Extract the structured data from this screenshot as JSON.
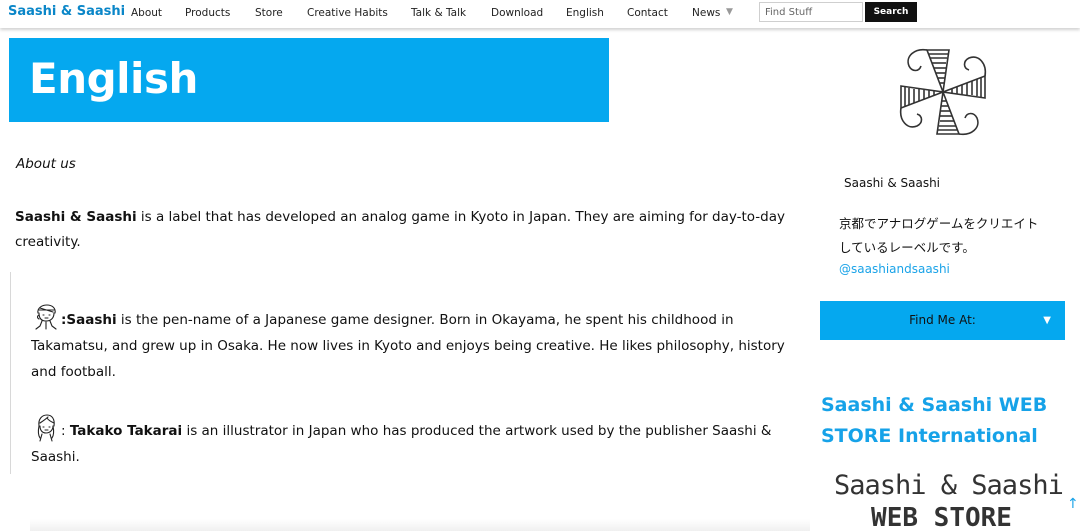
{
  "nav": {
    "brand": "Saashi & Saashi",
    "items": [
      {
        "label": "About"
      },
      {
        "label": "Products"
      },
      {
        "label": "Store"
      },
      {
        "label": "Creative Habits"
      },
      {
        "label": "Talk & Talk"
      },
      {
        "label": "Download"
      },
      {
        "label": "English"
      },
      {
        "label": "Contact"
      },
      {
        "label": "News"
      }
    ],
    "search_placeholder": "Find Stuff",
    "search_button": "Search"
  },
  "banner": {
    "title": "English"
  },
  "main": {
    "about_heading": "About us",
    "intro_bold": "Saashi & Saashi",
    "intro_rest": " is a label that has developed an analog game in Kyoto in Japan.  They are aiming for day-to-day creativity.",
    "person1": {
      "bold": ":Saashi",
      "text": " is the pen-name of a Japanese game designer.  Born in Okayama, he spent his childhood in Takamatsu, and grew up in Osaka. He now lives in Kyoto and enjoys being creative.  He likes philosophy, history and football."
    },
    "person2": {
      "prefix": ": ",
      "bold": "Takako Takarai",
      "text": " is an illustrator in Japan who has produced the artwork used by the publisher Saashi & Saashi."
    }
  },
  "sidebar": {
    "name": "Saashi & Saashi",
    "description": "京都でアナログゲームをクリエイトしているレーベルです。",
    "handle": "@saashiandsaashi",
    "find_me": "Find Me At:",
    "store_heading": "Saashi & Saashi WEB STORE International",
    "store_logo_line1": "Saashi & Saashi",
    "store_logo_line2": "WEB STORE"
  },
  "colors": {
    "accent": "#05a8ef",
    "link": "#1aa3e8",
    "brand": "#0a86c8"
  }
}
